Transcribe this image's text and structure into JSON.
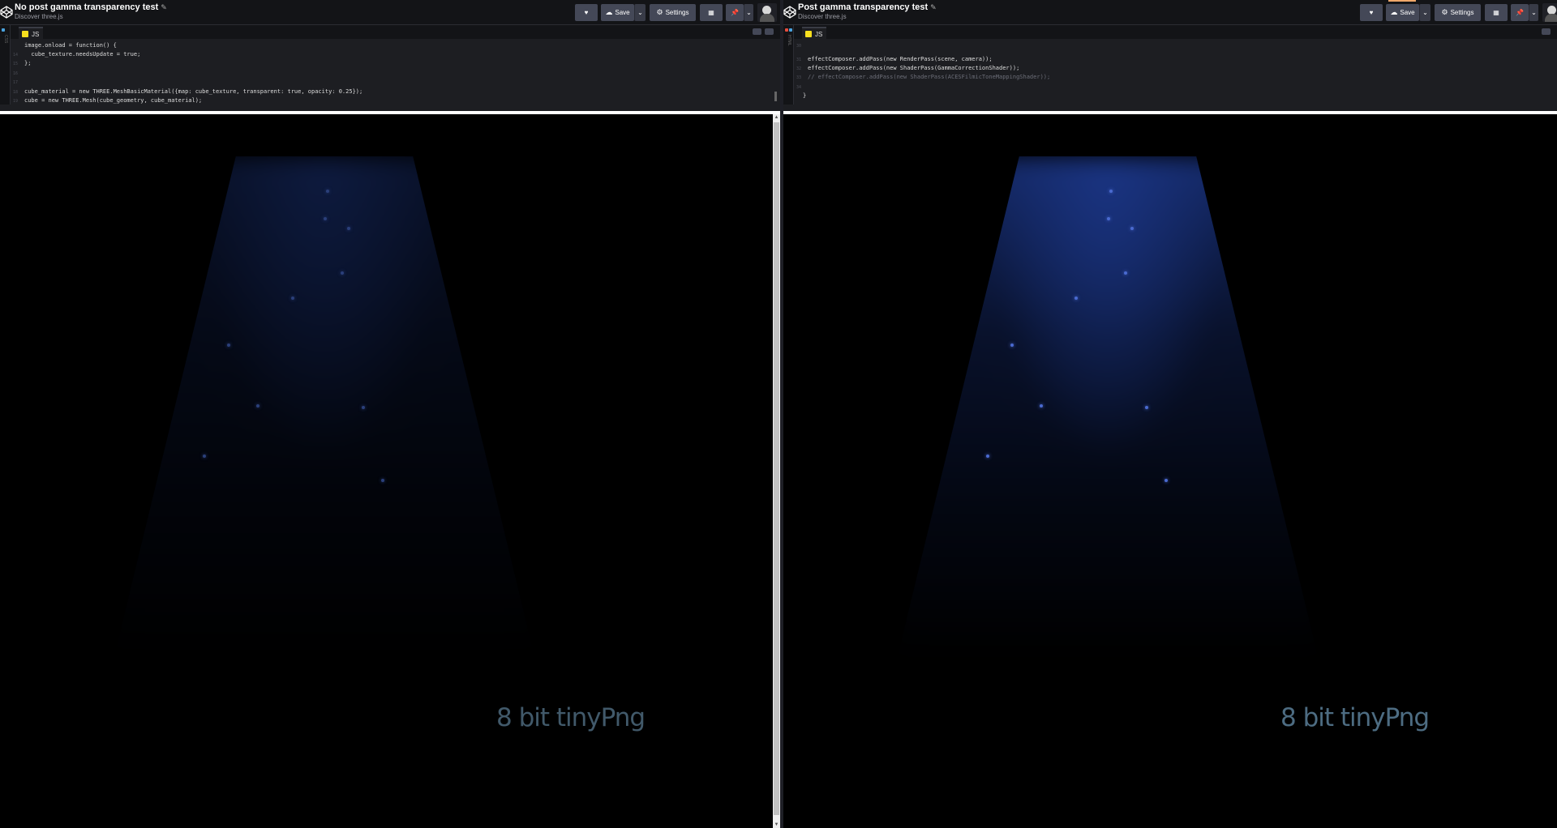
{
  "window_left": {
    "title": "No post gamma transparency test",
    "subtitle": "Discover three.js",
    "buttons": {
      "save": "Save",
      "settings": "Settings"
    },
    "editor": {
      "tab_label": "JS",
      "code_lines": [
        "image.onload = function() {",
        "  cube_texture.needsUpdate = true;",
        "};",
        "",
        "",
        "cube_material = new THREE.MeshBasicMaterial({map: cube_texture, transparent: true, opacity: 0.25});",
        "cube = new THREE.Mesh(cube_geometry, cube_material);"
      ]
    },
    "preview": {
      "watermark": "8 bit tinyPng"
    }
  },
  "window_right": {
    "title": "Post gamma transparency test",
    "subtitle": "Discover three.js",
    "buttons": {
      "save": "Save",
      "settings": "Settings"
    },
    "editor": {
      "tab_label": "JS",
      "code_lines": [
        "",
        "effectComposer.addPass(new RenderPass(scene, camera));",
        "effectComposer.addPass(new ShaderPass(GammaCorrectionShader));",
        "// effectComposer.addPass(new ShaderPass(ACESFilmicToneMappingShader));",
        "",
        "}"
      ]
    },
    "preview": {
      "watermark": "8 bit tinyPng"
    }
  },
  "icons": [
    "codepen-logo-icon",
    "pencil-icon",
    "heart-icon",
    "cloud-icon",
    "chevron-down-icon",
    "gear-icon",
    "layout-icon",
    "pin-icon",
    "avatar"
  ],
  "colors": {
    "topbar_bg": "#131417",
    "button_bg": "#444857",
    "editor_bg": "#1d1e22",
    "beam_left": "#0f1d45",
    "beam_right": "#1a3482",
    "watermark": "#41596a"
  }
}
